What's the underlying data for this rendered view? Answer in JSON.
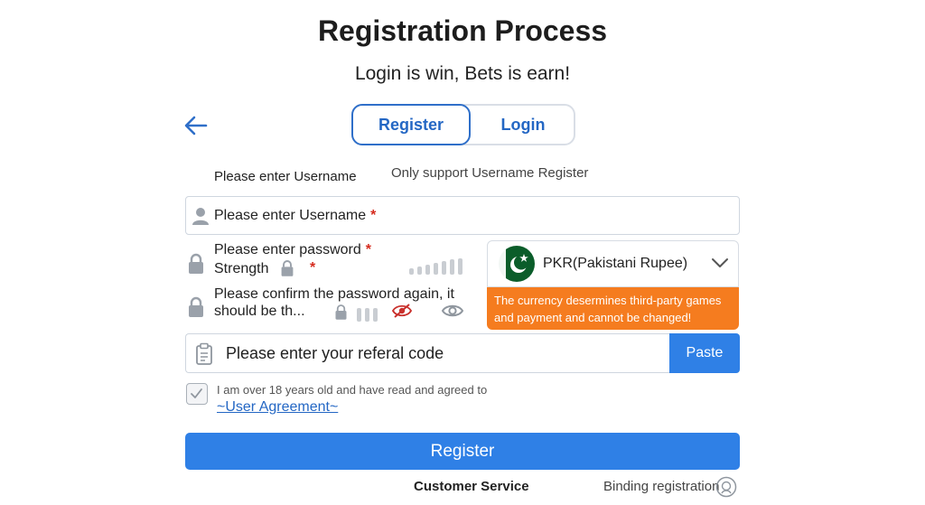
{
  "header": {
    "title": "Registration Process",
    "subtitle": "Login is win, Bets is earn!"
  },
  "tabs": {
    "register_label": "Register",
    "login_label": "Login",
    "active": "Register"
  },
  "hints": {
    "left": "Please enter Username",
    "right": "Only support Username Register"
  },
  "form": {
    "username_placeholder": "Please enter Username",
    "password_placeholder": "Please enter password",
    "strength_label": "Strength",
    "confirm_placeholder_line1": "Please confirm the password again, it",
    "confirm_placeholder_line2": "should be th...",
    "required_mark": "*",
    "referral_placeholder": "Please enter your referal code",
    "paste_label": "Paste"
  },
  "currency": {
    "selected": "PKR(Pakistani Rupee)",
    "warning": "The currency desermines third-party games and payment and cannot be changed!",
    "warning_color": "#f57c1f"
  },
  "agreement": {
    "text": "I am over 18 years old and have read and agreed to",
    "link": "~User Agreement~",
    "checked": true
  },
  "actions": {
    "register_label": "Register",
    "customer_service": "Customer Service",
    "binding_registration": "Binding registration"
  },
  "colors": {
    "accent": "#2f80e6",
    "tab_text": "#2467c4",
    "required": "#d52b1e",
    "flag_green": "#0b5d2a"
  },
  "icons": [
    "back-arrow-icon",
    "user-icon",
    "lock-icon",
    "eye-slash-icon",
    "eye-icon",
    "chevron-down-icon",
    "clipboard-icon",
    "check-icon",
    "pakistan-flag-icon",
    "support-face-icon"
  ]
}
